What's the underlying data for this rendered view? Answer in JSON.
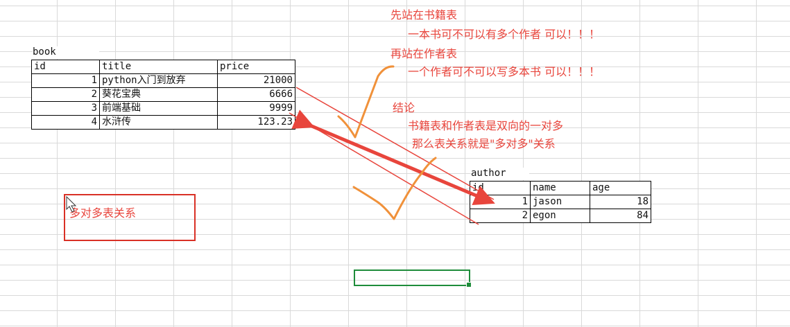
{
  "book": {
    "caption": "book",
    "headers": [
      "id",
      "title",
      "price"
    ],
    "rows": [
      {
        "id": "1",
        "title": "python入门到放弃",
        "price": "21000"
      },
      {
        "id": "2",
        "title": "葵花宝典",
        "price": "6666"
      },
      {
        "id": "3",
        "title": "前端基础",
        "price": "9999"
      },
      {
        "id": "4",
        "title": "水浒传",
        "price": "123.23"
      }
    ]
  },
  "author": {
    "caption": "author",
    "headers": [
      "id",
      "name",
      "age"
    ],
    "rows": [
      {
        "id": "1",
        "name": "jason",
        "age": "18"
      },
      {
        "id": "2",
        "name": "egon",
        "age": "84"
      }
    ]
  },
  "notes": {
    "line1": "先站在书籍表",
    "line2": "一本书可不可以有多个作者    可以！！！",
    "line3": "再站在作者表",
    "line4": "一个作者可不可以写多本书    可以！！！",
    "line5": "结论",
    "line6": "书籍表和作者表是双向的一对多",
    "line7": "那么表关系就是\"多对多\"关系"
  },
  "label_box": "多对多表关系",
  "colors": {
    "note_text": "#e8453c",
    "arrow": "#e8453c",
    "check": "#f0913a",
    "selection": "#1e8c3a"
  }
}
